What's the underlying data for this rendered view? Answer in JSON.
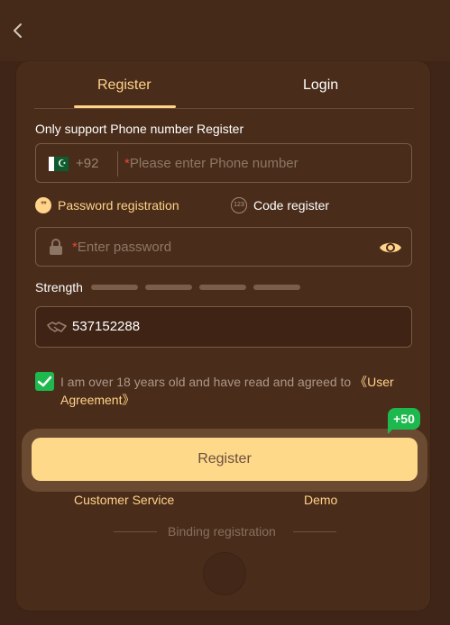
{
  "tabs": {
    "register": "Register",
    "login": "Login"
  },
  "subtitle": "Only support Phone number Register",
  "phone": {
    "country_code": "+92",
    "required_mark": "*",
    "placeholder": "Please enter Phone number",
    "flag": "pakistan-flag"
  },
  "reg_types": {
    "password": "Password registration",
    "password_icon": "**",
    "code": "Code register",
    "code_icon": "123"
  },
  "password": {
    "required_mark": "*",
    "placeholder": "Enter password"
  },
  "strength": {
    "label": "Strength",
    "level": 0,
    "segments": 4
  },
  "invite": {
    "value": "537152288"
  },
  "agreement": {
    "checked": true,
    "text": "I am over 18 years old and have read and agreed to ",
    "link": "《User Agreement》"
  },
  "register_button": {
    "label": "Register",
    "badge": "+50"
  },
  "links": {
    "customer_service": "Customer Service",
    "demo": "Demo"
  },
  "binding": {
    "label": "Binding registration"
  },
  "colors": {
    "accent": "#ffd38a",
    "background": "#4a2c1a",
    "success": "#1db94e",
    "button": "#ffd98a"
  }
}
